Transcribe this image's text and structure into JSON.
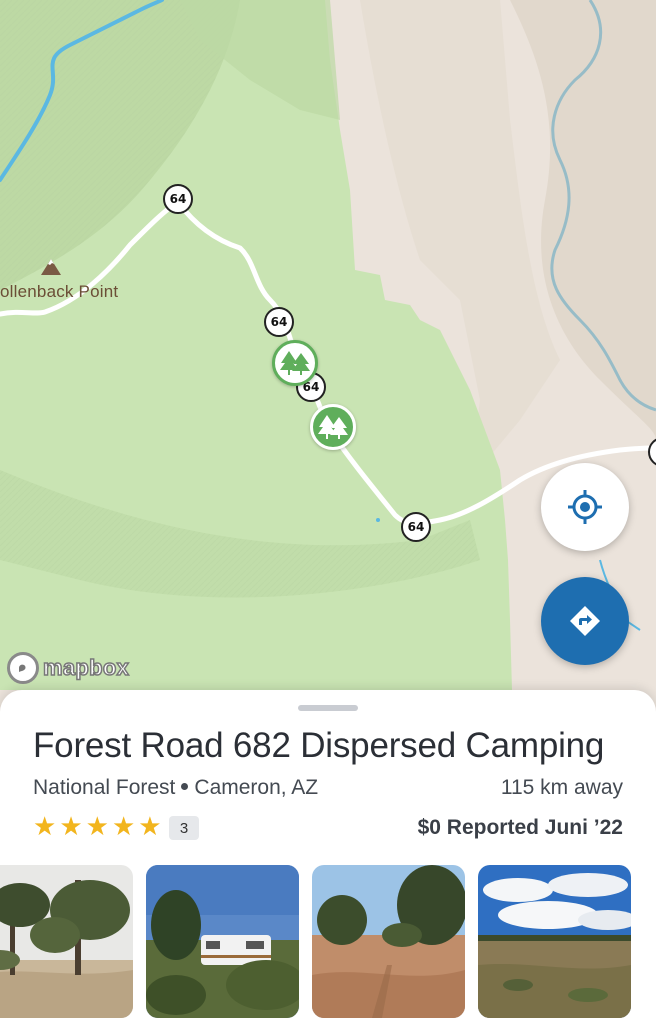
{
  "map": {
    "peak_label": "ollenback Point",
    "attribution": "mapbox",
    "route_shields": [
      "64",
      "64",
      "64",
      "64"
    ],
    "colors": {
      "forest_green": "#c6e3b0",
      "terrain": "#e9e2da",
      "river": "#5bb8e2",
      "camp_pin": "#5fae5b"
    },
    "pins": [
      {
        "name": "campground-pin-outline",
        "icon": "trees-icon"
      },
      {
        "name": "campground-pin-selected",
        "icon": "trees-icon"
      }
    ]
  },
  "controls": {
    "locate_icon": "crosshair-icon",
    "directions_icon": "directions-arrow-icon",
    "accent": "#1e6eb0"
  },
  "place": {
    "name": "Forest Road 682 Dispersed Camping",
    "category": "National Forest",
    "location": "Cameron, AZ",
    "distance": "115 km away",
    "rating": 5,
    "review_count": "3",
    "price": "$0 Reported Juni ’22",
    "star_color": "#f2b51e"
  },
  "photos": [
    {
      "name": "photo-1"
    },
    {
      "name": "photo-2"
    },
    {
      "name": "photo-3"
    },
    {
      "name": "photo-4"
    }
  ]
}
